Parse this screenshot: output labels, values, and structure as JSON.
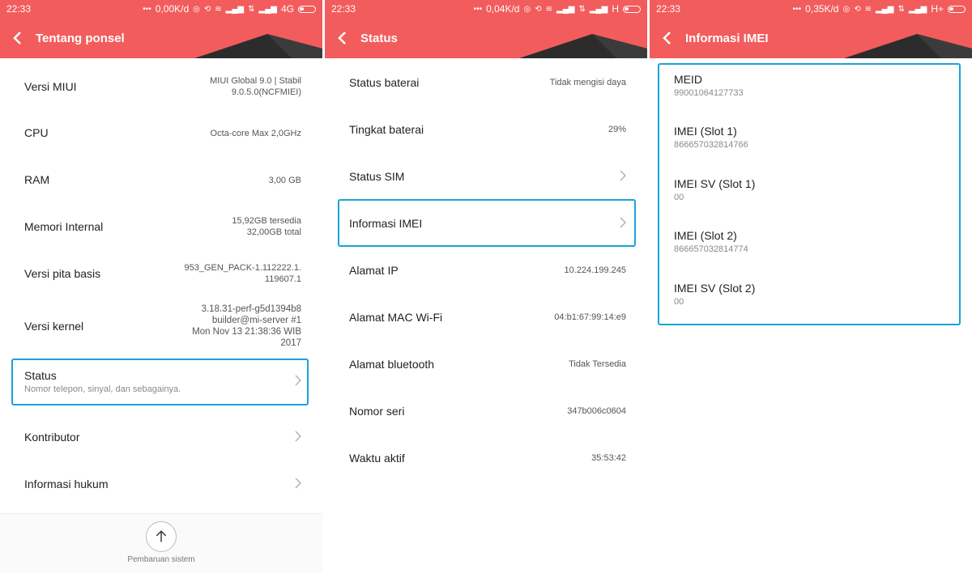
{
  "status_bars": [
    {
      "time": "22:33",
      "speed": "0,00K/d",
      "network": "4G"
    },
    {
      "time": "22:33",
      "speed": "0,04K/d",
      "network": "H"
    },
    {
      "time": "22:33",
      "speed": "0,35K/d",
      "network": "H+"
    }
  ],
  "panel1": {
    "title": "Tentang ponsel",
    "items": [
      {
        "label": "Versi MIUI",
        "value": "MIUI Global 9.0 | Stabil\n9.0.5.0(NCFMIEI)"
      },
      {
        "label": "CPU",
        "value": "Octa-core Max 2,0GHz"
      },
      {
        "label": "RAM",
        "value": "3,00 GB"
      },
      {
        "label": "Memori Internal",
        "value": "15,92GB tersedia\n32,00GB total"
      },
      {
        "label": "Versi pita basis",
        "value": "953_GEN_PACK-1.112222.1.\n119607.1"
      },
      {
        "label": "Versi kernel",
        "value": "3.18.31-perf-g5d1394b8\nbuilder@mi-server #1\nMon Nov 13 21:38:36 WIB\n2017"
      }
    ],
    "status": {
      "label": "Status",
      "subtitle": "Nomor telepon, sinyal, dan sebagainya."
    },
    "links": [
      {
        "label": "Kontributor"
      },
      {
        "label": "Informasi hukum"
      }
    ],
    "bottom_button": "Pembaruan sistem"
  },
  "panel2": {
    "title": "Status",
    "items": [
      {
        "label": "Status baterai",
        "value": "Tidak mengisi daya"
      },
      {
        "label": "Tingkat baterai",
        "value": "29%"
      },
      {
        "label": "Status SIM",
        "value": ""
      },
      {
        "label": "Informasi IMEI",
        "value": ""
      },
      {
        "label": "Alamat IP",
        "value": "10.224.199.245"
      },
      {
        "label": "Alamat MAC Wi-Fi",
        "value": "04:b1:67:99:14:e9"
      },
      {
        "label": "Alamat bluetooth",
        "value": "Tidak Tersedia"
      },
      {
        "label": "Nomor seri",
        "value": "347b006c0604"
      },
      {
        "label": "Waktu aktif",
        "value": "35:53:42"
      }
    ]
  },
  "panel3": {
    "title": "Informasi IMEI",
    "items": [
      {
        "label": "MEID",
        "value": "99001064127733"
      },
      {
        "label": "IMEI (Slot 1)",
        "value": "866657032814766"
      },
      {
        "label": "IMEI SV (Slot 1)",
        "value": "00"
      },
      {
        "label": "IMEI (Slot 2)",
        "value": "866657032814774"
      },
      {
        "label": "IMEI SV (Slot 2)",
        "value": "00"
      }
    ]
  },
  "colors": {
    "header": "#f35c5c",
    "highlight": "#1aa3d8"
  }
}
